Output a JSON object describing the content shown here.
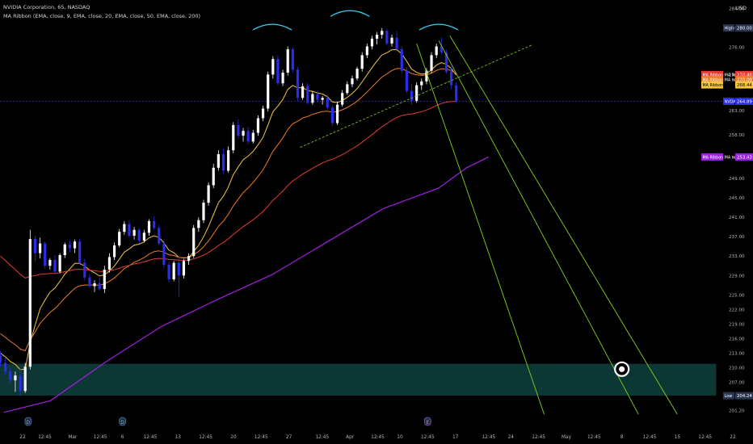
{
  "header": {
    "symbol_line": "NVIDIA Corporation, 65, NASDAQ",
    "indicator_line": "MA Ribbon (EMA, close, 9, EMA, close, 20, EMA, close, 50, EMA, close, 200)"
  },
  "currency": "USD",
  "colors": {
    "background": "#000000",
    "candle_up": "#ffffff",
    "candle_down": "#2a2eea",
    "ma9": "#f5c542",
    "ma20": "#f07a22",
    "ma50": "#e53935",
    "ma200": "#a020e0",
    "zone_fill": "#0e3a38",
    "channel": "#7fd31b",
    "trendline": "#7fd31b",
    "shoulders": "#35c7e6",
    "price_line": "#2a2eea"
  },
  "chart_data": {
    "type": "candlestick",
    "symbol": "NVDA",
    "timeframe": "65",
    "exchange": "NASDAQ",
    "y_ticks": [
      284.0,
      280.0,
      276.0,
      270.4,
      263.0,
      258.0,
      249.0,
      245.0,
      241.0,
      237.0,
      233.0,
      229.0,
      225.0,
      222.0,
      219.0,
      216.0,
      213.0,
      210.0,
      207.0,
      201.2
    ],
    "ylim": [
      200.6,
      284.6
    ],
    "x_ticks": [
      "22",
      "12:45",
      "Mar",
      "12:45",
      "6",
      "12:45",
      "13",
      "12:45",
      "20",
      "12:45",
      "27",
      "12:45",
      "Apr",
      "12:45",
      "10",
      "12:45",
      "17",
      "12:45",
      "24",
      "12:45",
      "May",
      "12:45",
      "8",
      "12:45",
      "15",
      "12:45",
      "22"
    ],
    "x_tick_index": [
      0,
      4,
      9,
      14,
      18,
      23,
      28,
      33,
      38,
      43,
      48,
      54,
      59,
      64,
      68,
      73,
      78,
      84,
      88,
      93,
      98,
      103,
      108,
      113,
      118,
      123,
      128
    ],
    "x_bar_range": [
      -4,
      128
    ],
    "price_labels": [
      {
        "label": "High",
        "value": "280.00",
        "price": 280.0,
        "kind": "high"
      },
      {
        "label": "MA Ribbon:MA №3",
        "value": "270.40",
        "price": 270.4,
        "kind": "ma50"
      },
      {
        "label": "MA Ribbon:MA №2",
        "value": "270.00",
        "price": 269.35,
        "kind": "ma20"
      },
      {
        "label": "MA Ribbon:MA №1",
        "value": "268.44",
        "price": 268.28,
        "kind": "ma9"
      },
      {
        "label": "NVDA",
        "value": "264.89",
        "price": 264.89,
        "kind": "last"
      },
      {
        "label": "MA Ribbon:MA №4",
        "value": "253.43",
        "price": 253.43,
        "kind": "ma200"
      },
      {
        "label": "Low",
        "value": "204.24",
        "price": 204.24,
        "kind": "low"
      }
    ],
    "support_zone": {
      "price_low": 204.24,
      "price_high": 210.8,
      "from_index": -4,
      "to_index": 125
    },
    "current_price": 264.89,
    "target_marker": {
      "index": 108,
      "price": 209.7
    },
    "events": [
      {
        "index": 1,
        "label": "D"
      },
      {
        "index": 18,
        "label": "D"
      },
      {
        "index": 73,
        "label": "E"
      }
    ],
    "series": [
      {
        "name": "Price",
        "kind": "ohlc"
      },
      {
        "name": "MA №1",
        "kind": "ma9"
      },
      {
        "name": "MA №2",
        "kind": "ma20"
      },
      {
        "name": "MA №3",
        "kind": "ma50"
      },
      {
        "name": "MA №4",
        "kind": "ma200"
      }
    ],
    "candles": [
      [
        212.5,
        213.5,
        210.2,
        211.0
      ],
      [
        211.0,
        212.0,
        208.5,
        209.2
      ],
      [
        209.2,
        210.0,
        206.8,
        207.4
      ],
      [
        207.4,
        209.2,
        205.0,
        208.4
      ],
      [
        208.4,
        209.8,
        204.2,
        205.2
      ],
      [
        205.2,
        211.0,
        204.8,
        210.2
      ],
      [
        210.2,
        238.4,
        209.6,
        236.5
      ],
      [
        236.5,
        237.2,
        232.0,
        233.6
      ],
      [
        233.6,
        236.8,
        232.5,
        235.6
      ],
      [
        235.6,
        236.0,
        230.4,
        231.0
      ],
      [
        231.0,
        232.6,
        230.2,
        232.2
      ],
      [
        232.2,
        233.2,
        229.2,
        229.8
      ],
      [
        229.8,
        233.6,
        229.4,
        233.2
      ],
      [
        233.2,
        235.8,
        232.6,
        235.4
      ],
      [
        235.4,
        236.2,
        233.8,
        234.6
      ],
      [
        234.6,
        236.4,
        233.6,
        236.0
      ],
      [
        236.0,
        236.6,
        231.2,
        231.6
      ],
      [
        231.6,
        232.4,
        228.0,
        228.6
      ],
      [
        228.6,
        229.2,
        226.4,
        226.8
      ],
      [
        226.8,
        228.0,
        225.6,
        227.4
      ],
      [
        227.4,
        228.6,
        225.8,
        226.2
      ],
      [
        226.2,
        231.0,
        225.4,
        230.2
      ],
      [
        230.2,
        233.6,
        229.6,
        232.8
      ],
      [
        232.8,
        235.8,
        232.2,
        235.2
      ],
      [
        235.2,
        238.6,
        234.8,
        238.0
      ],
      [
        238.0,
        240.2,
        237.4,
        239.6
      ],
      [
        239.6,
        240.4,
        236.8,
        237.2
      ],
      [
        237.2,
        239.0,
        236.4,
        238.4
      ],
      [
        238.4,
        238.8,
        235.6,
        236.2
      ],
      [
        236.2,
        238.4,
        235.8,
        237.8
      ],
      [
        237.8,
        240.6,
        237.2,
        240.2
      ],
      [
        240.2,
        241.2,
        238.4,
        238.8
      ],
      [
        238.8,
        239.4,
        235.2,
        235.6
      ],
      [
        235.6,
        236.2,
        230.6,
        231.2
      ],
      [
        231.2,
        231.8,
        227.6,
        228.2
      ],
      [
        228.2,
        232.0,
        227.8,
        231.6
      ],
      [
        231.6,
        232.8,
        224.6,
        229.0
      ],
      [
        229.0,
        232.4,
        228.4,
        232.0
      ],
      [
        232.0,
        233.6,
        231.2,
        233.0
      ],
      [
        233.0,
        239.4,
        232.6,
        238.8
      ],
      [
        238.8,
        241.0,
        238.0,
        240.4
      ],
      [
        240.4,
        244.6,
        239.8,
        244.0
      ],
      [
        244.0,
        248.2,
        243.4,
        247.6
      ],
      [
        247.6,
        252.0,
        247.0,
        251.2
      ],
      [
        251.2,
        254.8,
        250.6,
        254.0
      ],
      [
        254.0,
        255.2,
        250.0,
        250.6
      ],
      [
        250.6,
        255.6,
        250.2,
        254.8
      ],
      [
        254.8,
        260.6,
        254.2,
        260.0
      ],
      [
        260.0,
        261.2,
        257.2,
        257.8
      ],
      [
        257.8,
        259.4,
        256.6,
        258.8
      ],
      [
        258.8,
        259.6,
        256.0,
        256.6
      ],
      [
        256.6,
        259.0,
        256.2,
        258.4
      ],
      [
        258.4,
        262.0,
        257.8,
        261.4
      ],
      [
        261.4,
        264.0,
        260.8,
        263.4
      ],
      [
        263.4,
        271.0,
        262.8,
        270.4
      ],
      [
        270.4,
        274.2,
        269.6,
        273.6
      ],
      [
        273.6,
        274.4,
        268.2,
        268.6
      ],
      [
        268.6,
        271.4,
        268.0,
        270.8
      ],
      [
        270.8,
        276.2,
        270.2,
        275.6
      ],
      [
        275.6,
        276.0,
        270.8,
        271.4
      ],
      [
        271.4,
        272.0,
        265.0,
        265.6
      ],
      [
        265.6,
        268.6,
        265.2,
        268.0
      ],
      [
        268.0,
        268.6,
        264.2,
        264.6
      ],
      [
        264.6,
        267.0,
        264.2,
        266.4
      ],
      [
        266.4,
        267.2,
        264.6,
        265.2
      ],
      [
        265.2,
        266.0,
        264.2,
        265.6
      ],
      [
        265.6,
        266.2,
        263.2,
        263.6
      ],
      [
        263.6,
        264.2,
        259.8,
        260.4
      ],
      [
        260.4,
        264.8,
        260.0,
        264.2
      ],
      [
        264.2,
        267.2,
        263.8,
        266.6
      ],
      [
        266.6,
        269.0,
        266.2,
        268.4
      ],
      [
        268.4,
        270.2,
        267.8,
        269.6
      ],
      [
        269.6,
        272.0,
        269.2,
        271.6
      ],
      [
        271.6,
        275.0,
        271.0,
        274.4
      ],
      [
        274.4,
        276.8,
        273.8,
        276.2
      ],
      [
        276.2,
        278.4,
        275.6,
        277.8
      ],
      [
        277.8,
        279.2,
        276.6,
        278.6
      ],
      [
        278.6,
        280.0,
        277.8,
        279.4
      ],
      [
        279.4,
        279.8,
        276.4,
        276.8
      ],
      [
        276.8,
        278.6,
        276.2,
        278.0
      ],
      [
        278.0,
        279.4,
        275.2,
        275.6
      ],
      [
        275.6,
        276.2,
        270.6,
        271.2
      ],
      [
        271.2,
        272.0,
        266.6,
        267.0
      ],
      [
        267.0,
        268.4,
        264.2,
        265.0
      ],
      [
        265.0,
        268.8,
        264.6,
        268.2
      ],
      [
        268.2,
        269.6,
        267.2,
        269.0
      ],
      [
        269.0,
        271.8,
        268.4,
        271.2
      ],
      [
        271.2,
        275.0,
        270.6,
        274.4
      ],
      [
        274.4,
        276.8,
        273.8,
        276.2
      ],
      [
        276.2,
        278.0,
        274.6,
        275.0
      ],
      [
        275.0,
        275.6,
        270.6,
        271.0
      ],
      [
        271.0,
        272.0,
        267.4,
        268.2
      ],
      [
        268.2,
        268.8,
        264.6,
        264.89
      ]
    ],
    "candle_x0": -4,
    "candle_step": 0.893,
    "ema_periods": [
      9,
      20,
      50,
      200
    ],
    "ma200_points": [
      [
        -3.4,
        200.8
      ],
      [
        5,
        203.2
      ],
      [
        15,
        211.2
      ],
      [
        25,
        218.5
      ],
      [
        35,
        224.0
      ],
      [
        45,
        229.2
      ],
      [
        55,
        236.0
      ],
      [
        65,
        242.8
      ],
      [
        75,
        247.0
      ],
      [
        80,
        251.2
      ],
      [
        84,
        253.43
      ]
    ],
    "trendline": {
      "from": [
        50,
        255.4
      ],
      "to": [
        92,
        276.6
      ]
    },
    "channel_lines": [
      {
        "from": [
          71,
          276.8
        ],
        "to": [
          94,
          200.4
        ]
      },
      {
        "from": [
          75,
          277.4
        ],
        "to": [
          111,
          200.4
        ]
      },
      {
        "from": [
          77,
          278.4
        ],
        "to": [
          118,
          200.4
        ]
      }
    ],
    "shoulder_arcs": [
      {
        "from": 41.5,
        "to": 48.5,
        "price": 280.6
      },
      {
        "from": 55.5,
        "to": 62.5,
        "price": 283.4
      },
      {
        "from": 71.5,
        "to": 78.5,
        "price": 280.6
      }
    ]
  }
}
